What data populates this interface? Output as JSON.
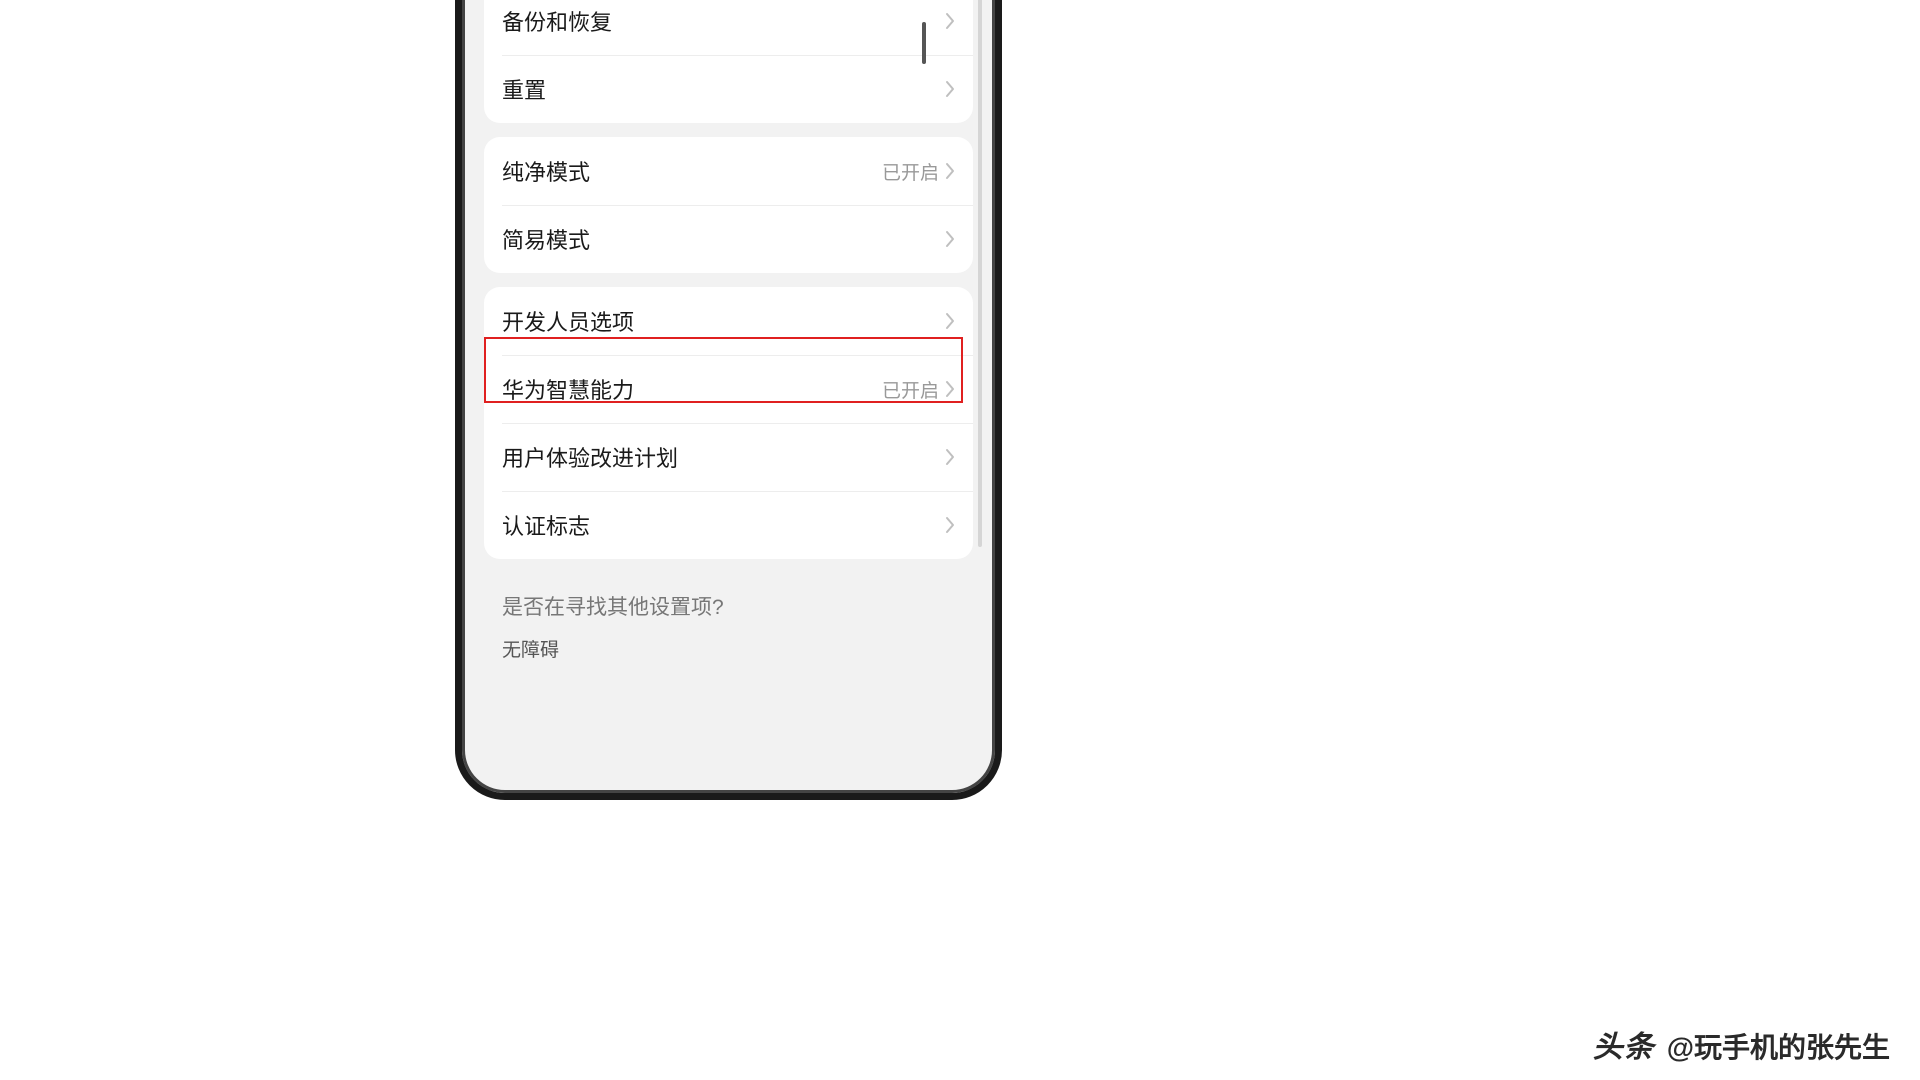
{
  "settings": {
    "group1": [
      {
        "label": "备份和恢复",
        "value": ""
      },
      {
        "label": "重置",
        "value": ""
      }
    ],
    "group2": [
      {
        "label": "纯净模式",
        "value": "已开启"
      },
      {
        "label": "简易模式",
        "value": ""
      }
    ],
    "group3": [
      {
        "label": "开发人员选项",
        "value": ""
      },
      {
        "label": "华为智慧能力",
        "value": "已开启"
      },
      {
        "label": "用户体验改进计划",
        "value": ""
      },
      {
        "label": "认证标志",
        "value": ""
      }
    ]
  },
  "footer": {
    "question": "是否在寻找其他设置项?",
    "link": "无障碍"
  },
  "watermark": {
    "brand": "头条",
    "author": "@玩手机的张先生"
  }
}
